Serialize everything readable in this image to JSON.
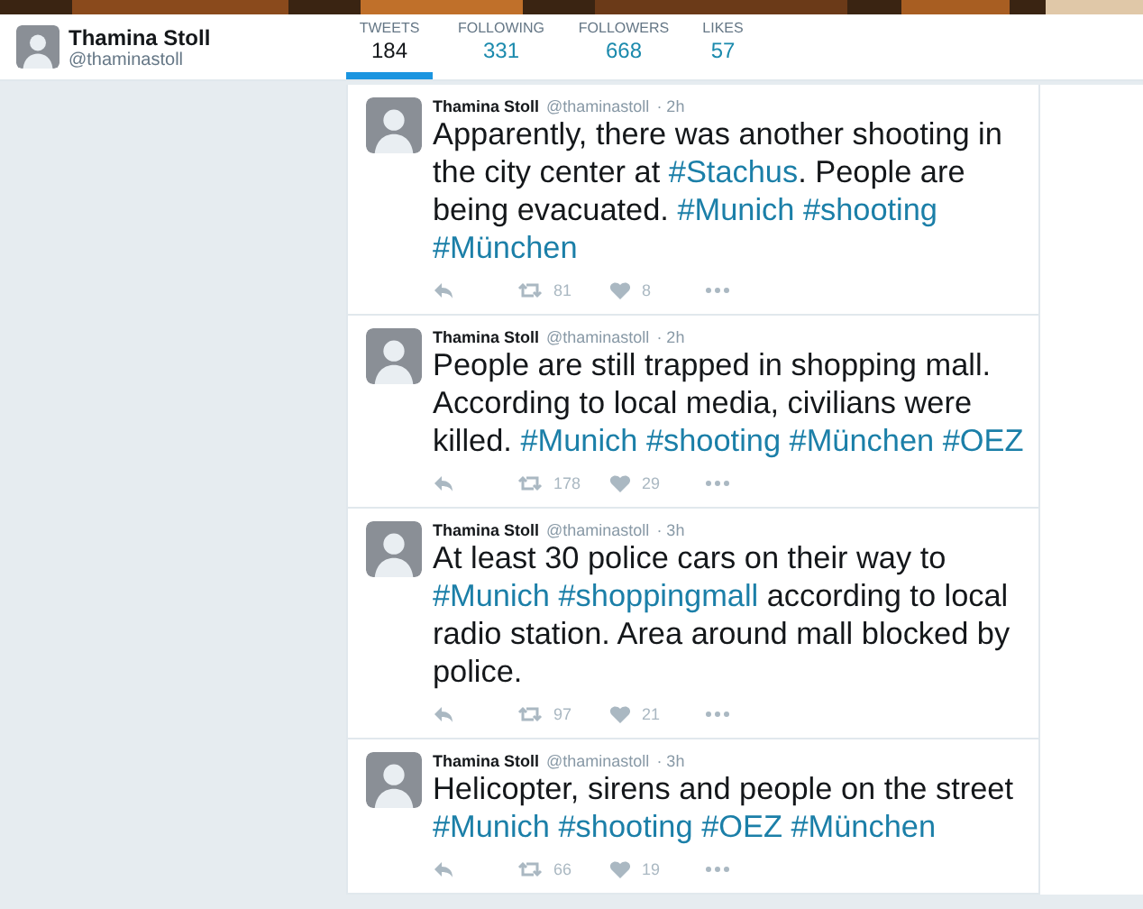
{
  "profile": {
    "name": "Thamina Stoll",
    "handle": "@thaminastoll"
  },
  "stats": [
    {
      "label": "TWEETS",
      "value": "184",
      "selected": true
    },
    {
      "label": "FOLLOWING",
      "value": "331",
      "selected": false
    },
    {
      "label": "FOLLOWERS",
      "value": "668",
      "selected": false
    },
    {
      "label": "LIKES",
      "value": "57",
      "selected": false
    }
  ],
  "tweets": [
    {
      "name": "Thamina Stoll",
      "handle": "@thaminastoll",
      "time": "· 2h",
      "parts": [
        {
          "kind": "text",
          "text": "Apparently, there was another shooting in the city center at "
        },
        {
          "kind": "hashtag",
          "text": "#Stachus"
        },
        {
          "kind": "text",
          "text": ". People are being evacuated. "
        },
        {
          "kind": "hashtag",
          "text": "#Munich"
        },
        {
          "kind": "hashtag",
          "text": "#shooting"
        },
        {
          "kind": "hashtag",
          "text": "#München"
        }
      ],
      "retweets": "81",
      "likes": "8"
    },
    {
      "name": "Thamina Stoll",
      "handle": "@thaminastoll",
      "time": "· 2h",
      "parts": [
        {
          "kind": "text",
          "text": "People are still trapped in shopping mall. According to local media, civilians were killed. "
        },
        {
          "kind": "hashtag",
          "text": "#Munich"
        },
        {
          "kind": "hashtag",
          "text": "#shooting"
        },
        {
          "kind": "hashtag",
          "text": "#München"
        },
        {
          "kind": "hashtag",
          "text": "#OEZ"
        }
      ],
      "retweets": "178",
      "likes": "29"
    },
    {
      "name": "Thamina Stoll",
      "handle": "@thaminastoll",
      "time": "· 3h",
      "parts": [
        {
          "kind": "text",
          "text": "At least 30 police cars on their way to "
        },
        {
          "kind": "hashtag",
          "text": "#Munich"
        },
        {
          "kind": "hashtag",
          "text": "#shoppingmall"
        },
        {
          "kind": "text",
          "text": " according to local radio station. Area around mall blocked by police."
        }
      ],
      "retweets": "97",
      "likes": "21"
    },
    {
      "name": "Thamina Stoll",
      "handle": "@thaminastoll",
      "time": "· 3h",
      "parts": [
        {
          "kind": "text",
          "text": "Helicopter, sirens and people on the street "
        },
        {
          "kind": "hashtag",
          "text": "#Munich"
        },
        {
          "kind": "hashtag",
          "text": "#shooting"
        },
        {
          "kind": "hashtag",
          "text": "#OEZ"
        },
        {
          "kind": "hashtag",
          "text": "#München"
        }
      ],
      "retweets": "66",
      "likes": "19"
    }
  ]
}
